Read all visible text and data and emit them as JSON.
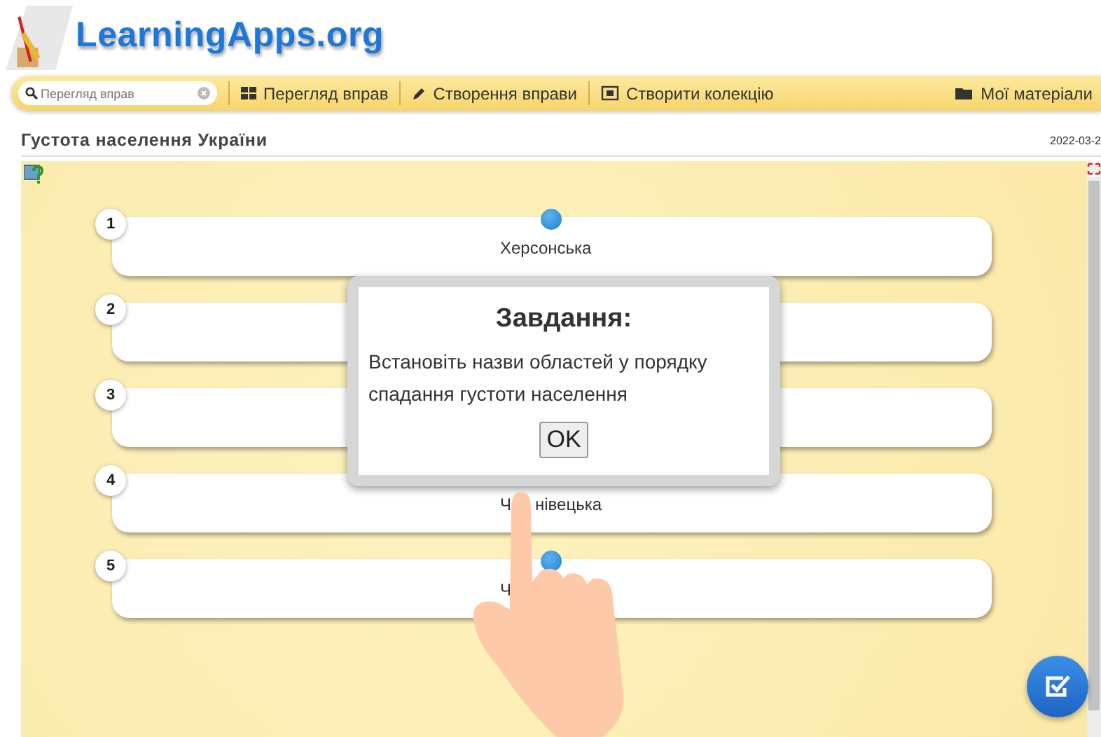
{
  "logo": {
    "text": "LearningApps.org"
  },
  "toolbar": {
    "search": {
      "placeholder": "Перегляд вправ"
    },
    "items": [
      {
        "label": "Перегляд вправ",
        "kind": "grid"
      },
      {
        "label": "Створення вправи",
        "kind": "pencil"
      },
      {
        "label": "Створити колекцію",
        "kind": "collection"
      }
    ],
    "right_item": {
      "label": "Мої матеріали",
      "kind": "folder"
    }
  },
  "title": "Густота населення України",
  "date": "2022-03-2",
  "items": [
    {
      "number": "1",
      "text_parts": [
        "Херсонська"
      ],
      "handle": true
    },
    {
      "number": "2",
      "handle": false
    },
    {
      "number": "3",
      "handle": false
    },
    {
      "number": "4",
      "text_parts": [
        "Ч",
        "нівецька"
      ],
      "handle": false
    },
    {
      "number": "5",
      "text_parts": [
        "Ч"
      ],
      "handle": true
    }
  ],
  "dialog": {
    "title": "Завдання:",
    "message": "Встановіть назви областей у порядку спадання густоти населення",
    "button": "OK"
  }
}
